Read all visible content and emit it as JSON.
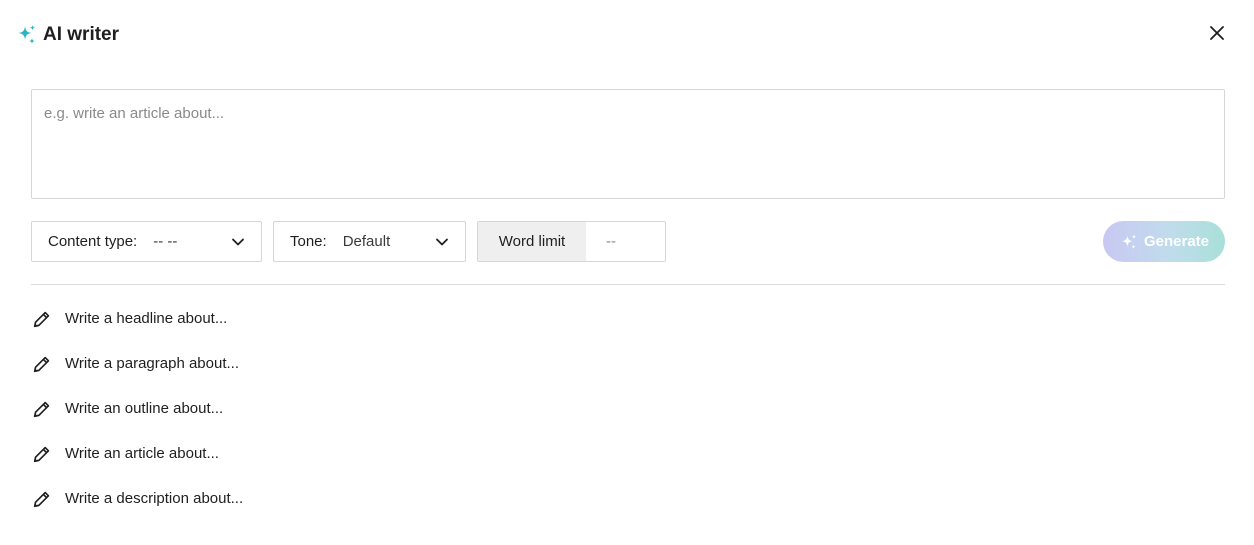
{
  "header": {
    "title": "AI writer",
    "icon": "sparkle-icon",
    "accent_color": "#2fb3c4"
  },
  "prompt": {
    "placeholder": "e.g. write an article about...",
    "value": ""
  },
  "controls": {
    "content_type": {
      "label": "Content type:",
      "value": "-- --"
    },
    "tone": {
      "label": "Tone:",
      "value": "Default"
    },
    "word_limit": {
      "label": "Word limit",
      "placeholder": "--",
      "value": ""
    }
  },
  "generate": {
    "label": "Generate",
    "enabled": false
  },
  "suggestions": [
    {
      "label": "Write a headline about..."
    },
    {
      "label": "Write a paragraph about..."
    },
    {
      "label": "Write an outline about..."
    },
    {
      "label": "Write an article about..."
    },
    {
      "label": "Write a description about..."
    }
  ]
}
